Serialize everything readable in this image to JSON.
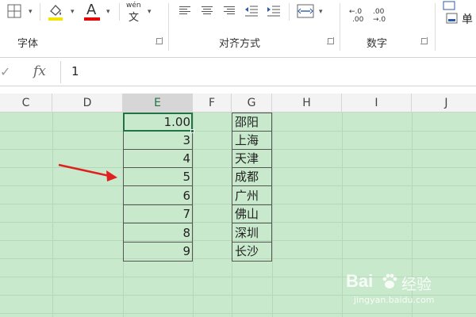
{
  "ribbon": {
    "groups": [
      {
        "label": "字体"
      },
      {
        "label": "对齐方式"
      },
      {
        "label": "数字"
      }
    ],
    "wen_label": "wén",
    "wen_char": "文",
    "font_color_letter": "A",
    "dec_increase": ".00",
    "dec_increase_top": "←.0",
    "dec_decrease": ".00",
    "dec_decrease_bottom": "→.0",
    "cut_text": "单"
  },
  "formula_bar": {
    "fx_label": "fx",
    "value": "1"
  },
  "columns": [
    "C",
    "D",
    "E",
    "F",
    "G",
    "H",
    "I",
    "J"
  ],
  "selected_column": "E",
  "table": {
    "numbers": [
      "1.00",
      "3",
      "4",
      "5",
      "6",
      "7",
      "8",
      "9"
    ],
    "cities": [
      "邵阳",
      "上海",
      "天津",
      "成都",
      "广州",
      "佛山",
      "深圳",
      "长沙"
    ]
  },
  "watermark": {
    "brand": "Bai",
    "brand2": "经验",
    "url": "jingyan.baidu.com"
  },
  "colors": {
    "sheet_bg": "#c9e9cc",
    "accent": "#217346",
    "arrow": "#e02020",
    "fill_yellow": "#f2e600",
    "font_red": "#e00000"
  }
}
